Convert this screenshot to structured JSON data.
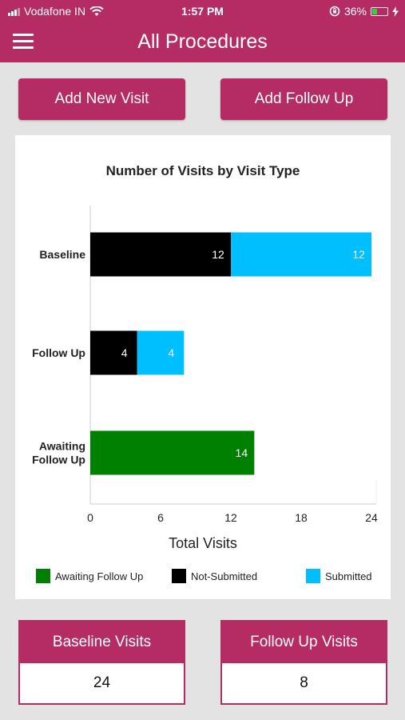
{
  "status_bar": {
    "carrier": "Vodafone IN",
    "time": "1:57 PM",
    "battery": "36%",
    "battery_level": 0.36,
    "icons": [
      "signal-icon",
      "wifi-icon",
      "rotation-lock-icon",
      "battery-icon",
      "charging-icon"
    ]
  },
  "navbar": {
    "title": "All Procedures",
    "menu_icon": "hamburger-menu-icon"
  },
  "actions": {
    "add_new_visit": "Add New Visit",
    "add_follow_up": "Add Follow Up"
  },
  "colors": {
    "brand": "#b52b64",
    "awaiting": "#008000",
    "not_submitted": "#000000",
    "submitted": "#00bfff"
  },
  "chart_data": {
    "type": "bar",
    "orientation": "horizontal",
    "stacked": true,
    "title": "Number of Visits by Visit Type",
    "xlabel": "Total Visits",
    "ylabel": "",
    "xlim": [
      0,
      24
    ],
    "xticks": [
      0,
      6,
      12,
      18,
      24
    ],
    "categories": [
      "Baseline",
      "Follow Up",
      "Awaiting Follow Up"
    ],
    "series": [
      {
        "name": "Not-Submitted",
        "color": "#000000",
        "values": [
          12,
          4,
          0
        ]
      },
      {
        "name": "Submitted",
        "color": "#00bfff",
        "values": [
          12,
          4,
          0
        ]
      },
      {
        "name": "Awaiting Follow Up",
        "color": "#008000",
        "values": [
          0,
          0,
          14
        ]
      }
    ],
    "legend": [
      {
        "name": "Awaiting Follow Up",
        "color": "#008000"
      },
      {
        "name": "Not-Submitted",
        "color": "#000000"
      },
      {
        "name": "Submitted",
        "color": "#00bfff"
      }
    ],
    "legend_position": "bottom",
    "grid": false
  },
  "stats": {
    "baseline": {
      "label": "Baseline Visits",
      "value": "24"
    },
    "follow_up": {
      "label": "Follow Up Visits",
      "value": "8"
    }
  }
}
